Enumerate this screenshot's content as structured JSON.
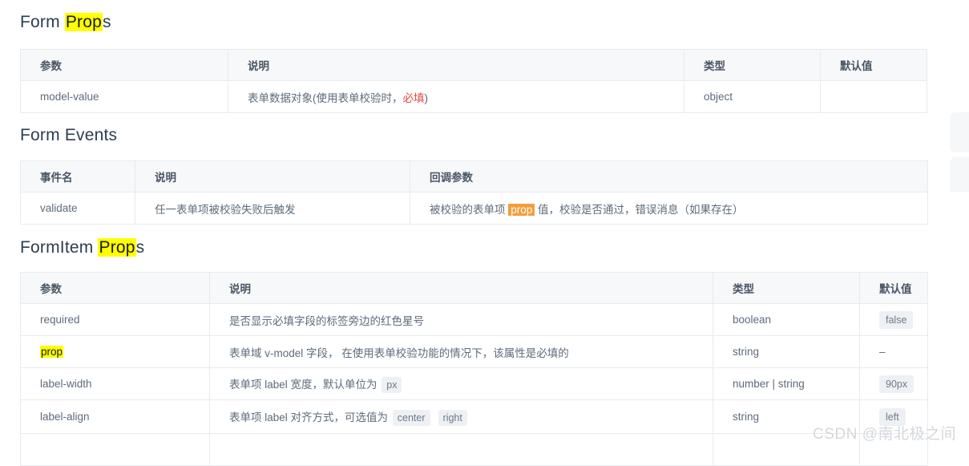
{
  "sections": [
    {
      "heading_prefix": "Form ",
      "heading_highlight": "Prop",
      "heading_suffix": "s",
      "columns": [
        "参数",
        "说明",
        "类型",
        "默认值"
      ],
      "rows": [
        {
          "param": "model-value",
          "desc_prefix": "表单数据对象(使用表单校验时，",
          "desc_required": "必填",
          "desc_suffix": ")",
          "type": "object",
          "default": ""
        }
      ]
    },
    {
      "heading_prefix": "Form Events",
      "heading_highlight": "",
      "heading_suffix": "",
      "columns": [
        "事件名",
        "说明",
        "回调参数"
      ],
      "rows": [
        {
          "param": "validate",
          "desc": "任一表单项被校验失败后触发",
          "callback_prefix": "被校验的表单项 ",
          "callback_highlight": "prop",
          "callback_suffix": " 值，校验是否通过，错误消息（如果存在）"
        }
      ]
    },
    {
      "heading_prefix": "FormItem ",
      "heading_highlight": "Prop",
      "heading_suffix": "s",
      "columns": [
        "参数",
        "说明",
        "类型",
        "默认值"
      ],
      "rows": [
        {
          "param": "required",
          "param_highlight": false,
          "desc": "是否显示必填字段的标签旁边的红色星号",
          "desc_codes": [],
          "type": "boolean",
          "default": "false",
          "default_is_code": true
        },
        {
          "param": "prop",
          "param_highlight": true,
          "desc": "表单域 v-model 字段， 在使用表单校验功能的情况下，该属性是必填的",
          "desc_codes": [],
          "type": "string",
          "default": "–",
          "default_is_code": false
        },
        {
          "param": "label-width",
          "param_highlight": false,
          "desc": "表单项 label 宽度，默认单位为 ",
          "desc_codes": [
            "px"
          ],
          "type": "number | string",
          "default": "90px",
          "default_is_code": true
        },
        {
          "param": "label-align",
          "param_highlight": false,
          "desc": "表单项 label 对齐方式，可选值为 ",
          "desc_codes": [
            "center",
            "right"
          ],
          "type": "string",
          "default": "left",
          "default_is_code": true
        }
      ]
    }
  ],
  "watermark": "CSDN @南北极之间",
  "colors": {
    "highlight_yellow": "#ffff00",
    "highlight_orange": "#f59d3c",
    "required_red": "#e4483b",
    "table_header_bg": "#f6f8fa",
    "table_border": "#e8eaec",
    "code_bg": "#eef0f3",
    "code_text": "#6b7b8d"
  }
}
